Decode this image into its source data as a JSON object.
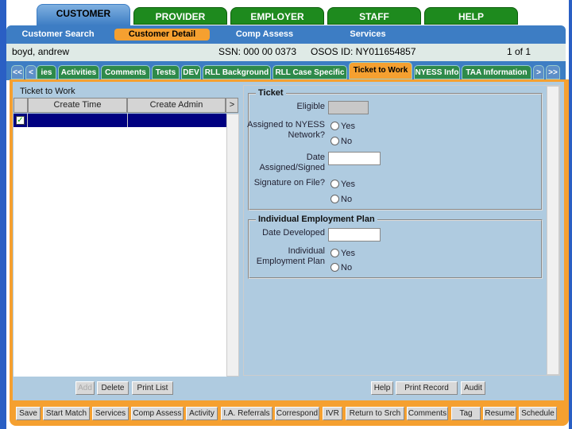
{
  "top_tabs": [
    {
      "label": "CUSTOMER",
      "active": true
    },
    {
      "label": "PROVIDER"
    },
    {
      "label": "EMPLOYER"
    },
    {
      "label": "STAFF"
    },
    {
      "label": "HELP"
    }
  ],
  "subnav": [
    {
      "label": "Customer Search"
    },
    {
      "label": "Customer Detail",
      "active": true
    },
    {
      "label": "Comp Assess"
    },
    {
      "label": "Services"
    }
  ],
  "customer": {
    "name": "boyd, andrew",
    "ssn": "SSN: 000 00 0373",
    "osos_id": "OSOS ID: NY011654857",
    "record": "1 of 1"
  },
  "section_tabs": [
    {
      "label": "<<"
    },
    {
      "label": "<"
    },
    {
      "label": "ies"
    },
    {
      "label": "Activities"
    },
    {
      "label": "Comments"
    },
    {
      "label": "Tests"
    },
    {
      "label": "DEV"
    },
    {
      "label": "RLL Background"
    },
    {
      "label": "RLL Case Specific"
    },
    {
      "label": "Ticket to Work",
      "active": true
    },
    {
      "label": "NYESS Info"
    },
    {
      "label": "TAA Information"
    },
    {
      "label": ">"
    },
    {
      "label": ">>"
    }
  ],
  "left": {
    "title": "Ticket to Work",
    "columns": [
      "Create Time",
      "Create Admin"
    ],
    "more": ">",
    "rows": [
      {
        "checked": true,
        "create_time": "",
        "create_admin": ""
      }
    ],
    "buttons": {
      "add": "Add",
      "delete": "Delete",
      "print_list": "Print List"
    }
  },
  "ticket": {
    "legend": "Ticket",
    "eligible_label": "Eligible",
    "eligible_value": "",
    "assigned_label": "Assigned to NYESS Network?",
    "date_label": "Date Assigned/Signed",
    "date_value": "",
    "signature_label": "Signature on File?",
    "yes": "Yes",
    "no": "No"
  },
  "iep": {
    "legend": "Individual Employment Plan",
    "date_label": "Date Developed",
    "date_value": "",
    "plan_label": "Individual Employment Plan",
    "yes": "Yes",
    "no": "No"
  },
  "right_buttons": {
    "help": "Help",
    "print_record": "Print Record",
    "audit": "Audit"
  },
  "bottom_bar": [
    "Save",
    "Start Match",
    "Services",
    "Comp Assess",
    "Activity",
    "I.A. Referrals",
    "Correspond",
    "IVR",
    "Return to Srch",
    "Comments",
    "Tag",
    "Resume",
    "Schedule"
  ],
  "colors": {
    "brand_blue": "#3d7dc4",
    "accent_orange": "#f5a030",
    "tab_green": "#1e8a1e",
    "panel_blue": "#afcbe0",
    "selected_row": "#000080"
  }
}
